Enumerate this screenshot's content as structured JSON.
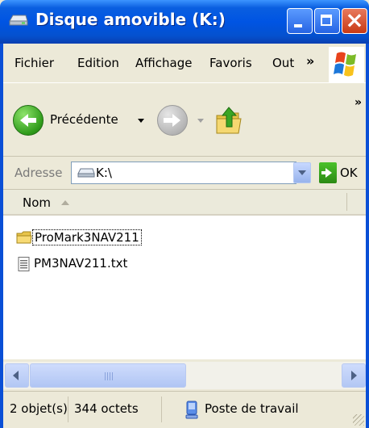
{
  "window": {
    "title": "Disque amovible (K:)",
    "colors": {
      "titlebar": "#0054e3",
      "close": "#c83a14",
      "accent_green": "#2f9b1a"
    }
  },
  "menubar": {
    "items": [
      "Fichier",
      "Edition",
      "Affichage",
      "Favoris",
      "Out"
    ],
    "more": "»"
  },
  "toolbar": {
    "back_label": "Précédente",
    "more": "»"
  },
  "address": {
    "label": "Adresse",
    "value": "K:\\",
    "go_label": "OK"
  },
  "columns": {
    "name": "Nom"
  },
  "files": [
    {
      "name": "ProMark3NAV211",
      "type": "folder-icon",
      "focused": true
    },
    {
      "name": "PM3NAV211.txt",
      "type": "text-file-icon",
      "focused": false
    }
  ],
  "status": {
    "count": "2 objet(s)",
    "size": "344 octets",
    "zone": "Poste de travail"
  }
}
